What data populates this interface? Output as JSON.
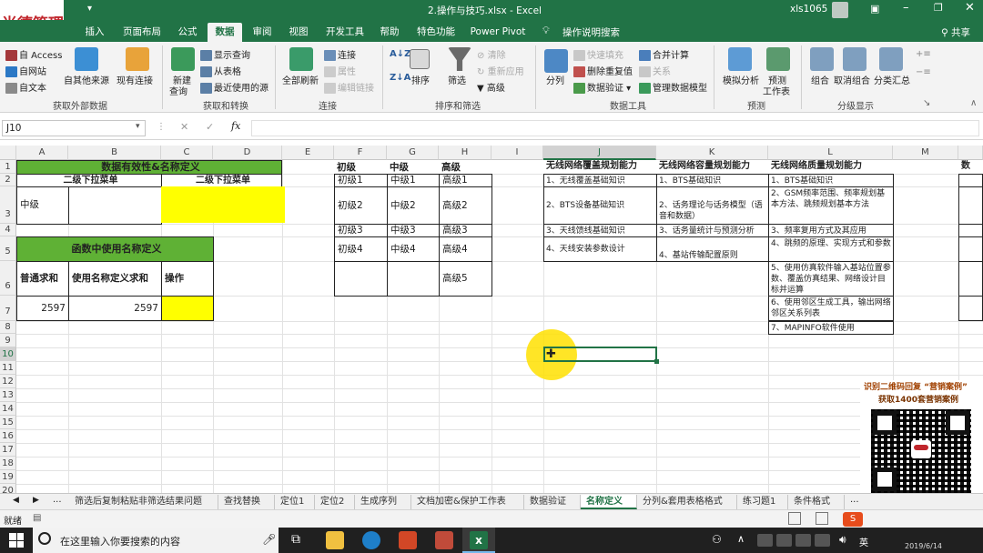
{
  "app": {
    "logo": "尚德管理",
    "title": "2.操作与技巧.xlsx - Excel",
    "user": "xls1065",
    "share": "共享",
    "tellme": "操作说明搜索"
  },
  "tabs": [
    "插入",
    "页面布局",
    "公式",
    "数据",
    "审阅",
    "视图",
    "开发工具",
    "帮助",
    "特色功能",
    "Power Pivot"
  ],
  "ribbon": {
    "ext": {
      "access": "自 Access",
      "web": "自网站",
      "text": "自文本",
      "other": "自其他来源",
      "existing": "现有连接",
      "label": "获取外部数据"
    },
    "transform": {
      "new_query_1": "新建",
      "new_query_2": "查询",
      "show": "显示查询",
      "table": "从表格",
      "recent": "最近使用的源",
      "label": "获取和转换"
    },
    "conn": {
      "refresh": "全部刷新",
      "conn": "连接",
      "props": "属性",
      "edit": "编辑链接",
      "label": "连接"
    },
    "sort": {
      "sort": "排序",
      "filter": "筛选",
      "clear": "清除",
      "reapply": "重新应用",
      "adv": "高级",
      "label": "排序和筛选"
    },
    "tools": {
      "split": "分列",
      "flash": "快速填充",
      "dup": "删除重复值",
      "valid": "数据验证",
      "merge": "合并计算",
      "rel": "关系",
      "model": "管理数据模型",
      "label": "数据工具"
    },
    "fc": {
      "whatif": "模拟分析",
      "sheet_1": "预测",
      "sheet_2": "工作表",
      "label": "预测"
    },
    "outline": {
      "group": "组合",
      "ungroup": "取消组合",
      "sub": "分类汇总",
      "label": "分级显示"
    }
  },
  "formula": {
    "namebox": "J10",
    "fx": "fx",
    "value": ""
  },
  "columns": [
    "A",
    "B",
    "C",
    "D",
    "E",
    "F",
    "G",
    "H",
    "I",
    "J",
    "K",
    "L",
    "M"
  ],
  "rows": [
    "1",
    "2",
    "3",
    "4",
    "5",
    "6",
    "7",
    "8",
    "9",
    "10",
    "11",
    "12",
    "13",
    "14",
    "15",
    "16",
    "17",
    "18",
    "19",
    "20",
    "21"
  ],
  "left": {
    "title1": "数据有效性&名称定义",
    "dd1": "二级下拉菜单",
    "dd2": "二级下拉菜单",
    "a3": "中级",
    "title2": "函数中使用名称定义",
    "h1": "普通求和",
    "h2": "使用名称定义求和",
    "h3": "操作",
    "v1": "2597",
    "v2": "2597"
  },
  "levels": {
    "header": [
      "初级",
      "中级",
      "高级"
    ],
    "rows": [
      [
        "初级1",
        "中级1",
        "高级1"
      ],
      [
        "初级2",
        "中级2",
        "高级2"
      ],
      [
        "初级3",
        "中级3",
        "高级3"
      ],
      [
        "初级4",
        "中级4",
        "高级4"
      ],
      [
        "",
        "",
        "高级5"
      ]
    ]
  },
  "skills": {
    "h_j": "无线网络覆盖规划能力",
    "h_k": "无线网络容量规划能力",
    "h_l": "无线网络质量规划能力",
    "h_n": "数",
    "j": [
      "1、无线覆盖基础知识",
      "2、BTS设备基础知识",
      "3、天线馈线基础知识",
      "4、天线安装参数设计"
    ],
    "k": [
      "1、BTS基础知识",
      "2、话务理论与话务模型（语音和数据）",
      "3、话务量统计与预测分析",
      "4、基站传输配置原则"
    ],
    "l": [
      "1、BTS基础知识",
      "2、GSM频率范围、频率规划基本方法、跳频规划基本方法",
      "3、频率复用方式及其应用",
      "4、跳频的原理、实现方式和参数",
      "5、使用仿真软件输入基站位置参数、覆盖仿真结果、网络设计目标并运算",
      "6、使用邻区生成工具，输出网络邻区关系列表",
      "7、MAPINFO软件使用"
    ]
  },
  "qr": {
    "line1": "识别二维码回复 “营销案例”",
    "line2": "获取1400套营销案例"
  },
  "sheets": [
    "筛选后复制粘贴非筛选结果问题",
    "查找替换",
    "定位1",
    "定位2",
    "生成序列",
    "文档加密&保护工作表",
    "数据验证",
    "名称定义",
    "分列&套用表格格式",
    "练习题1",
    "条件格式"
  ],
  "status": {
    "ready": "就绪"
  },
  "taskbar": {
    "search": "在这里输入你要搜索的内容",
    "date": "2019/6/14",
    "ime": "英"
  }
}
